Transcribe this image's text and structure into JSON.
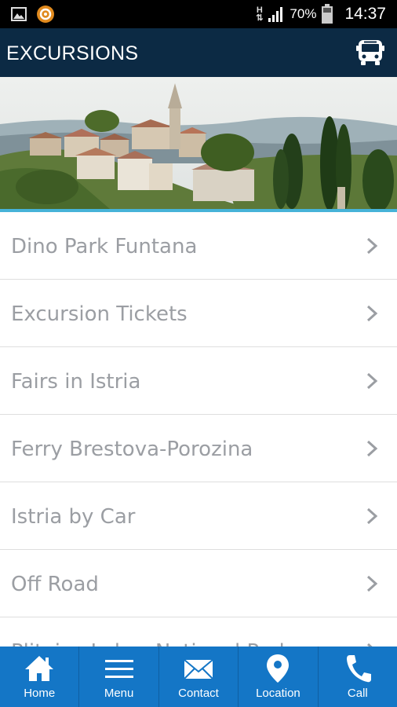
{
  "status_bar": {
    "network": "H",
    "battery_percent": "70%",
    "time": "14:37",
    "icons": [
      "gallery-icon",
      "notification-app-icon",
      "signal-icon",
      "battery-icon"
    ]
  },
  "app_bar": {
    "title": "EXCURSIONS",
    "action_icon": "bus-icon",
    "color": "#0c2a44"
  },
  "hero": {
    "accent_line_color": "#46b3d8"
  },
  "list": {
    "items": [
      {
        "label": "Dino Park Funtana"
      },
      {
        "label": "Excursion Tickets"
      },
      {
        "label": "Fairs in Istria"
      },
      {
        "label": "Ferry Brestova-Porozina"
      },
      {
        "label": "Istria by Car"
      },
      {
        "label": "Off Road"
      },
      {
        "label": "Plitvice Lakes National Park"
      }
    ]
  },
  "bottom_nav": {
    "color": "#1476c6",
    "items": [
      {
        "label": "Home",
        "icon": "home-icon"
      },
      {
        "label": "Menu",
        "icon": "menu-icon"
      },
      {
        "label": "Contact",
        "icon": "mail-icon"
      },
      {
        "label": "Location",
        "icon": "location-pin-icon"
      },
      {
        "label": "Call",
        "icon": "phone-icon"
      }
    ]
  }
}
